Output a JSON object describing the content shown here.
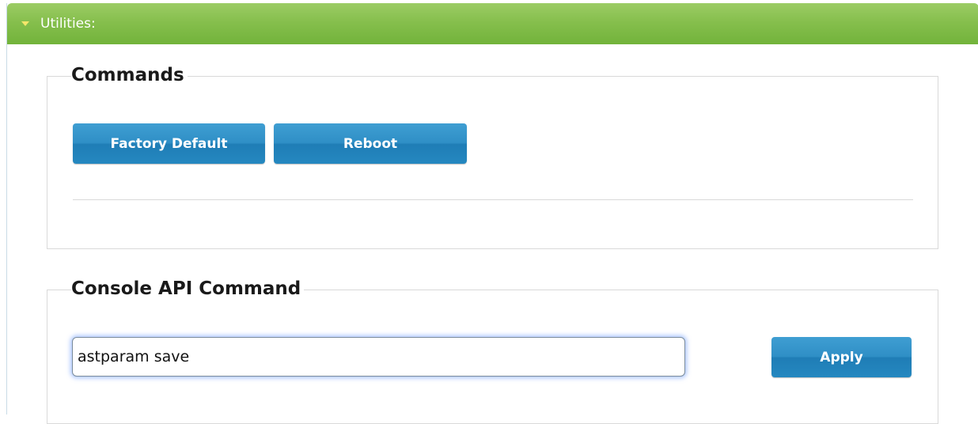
{
  "panel": {
    "title": "Utilities:"
  },
  "commands": {
    "legend": "Commands",
    "factory_default_label": "Factory Default",
    "reboot_label": "Reboot"
  },
  "console": {
    "legend": "Console API Command",
    "input_value": "astparam save",
    "apply_label": "Apply"
  },
  "colors": {
    "header_green": "#86bf4d",
    "button_blue": "#2f8fc6",
    "caret_yellow": "#f4e66a"
  }
}
